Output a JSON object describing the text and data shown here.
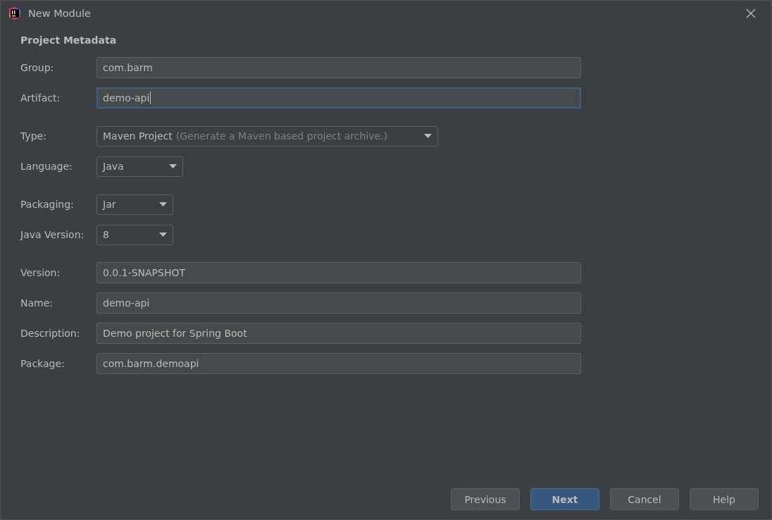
{
  "window": {
    "title": "New Module"
  },
  "section_title": "Project Metadata",
  "groups": [
    {
      "fields": [
        {
          "label": "Group:",
          "kind": "text",
          "value": "com.barm",
          "focused": false
        },
        {
          "label": "Artifact:",
          "kind": "text",
          "value": "demo-api",
          "focused": true
        }
      ]
    },
    {
      "fields": [
        {
          "label": "Type:",
          "kind": "dropdown",
          "value": "Maven Project",
          "hint": "(Generate a Maven based project archive.)",
          "focused": false
        },
        {
          "label": "Language:",
          "kind": "dropdown",
          "value": "Java",
          "focused": false
        }
      ]
    },
    {
      "fields": [
        {
          "label": "Packaging:",
          "kind": "dropdown",
          "value": "Jar",
          "focused": false
        },
        {
          "label": "Java Version:",
          "kind": "dropdown",
          "value": "8",
          "focused": false
        }
      ]
    },
    {
      "fields": [
        {
          "label": "Version:",
          "kind": "text",
          "value": "0.0.1-SNAPSHOT",
          "focused": false
        },
        {
          "label": "Name:",
          "kind": "text",
          "value": "demo-api",
          "focused": false
        },
        {
          "label": "Description:",
          "kind": "text",
          "value": "Demo project for Spring Boot",
          "focused": false
        },
        {
          "label": "Package:",
          "kind": "text",
          "value": "com.barm.demoapi",
          "focused": false
        }
      ]
    }
  ],
  "buttons": [
    {
      "label": "Previous",
      "default": false
    },
    {
      "label": "Next",
      "default": true
    },
    {
      "label": "Cancel",
      "default": false
    },
    {
      "label": "Help",
      "default": false
    }
  ]
}
